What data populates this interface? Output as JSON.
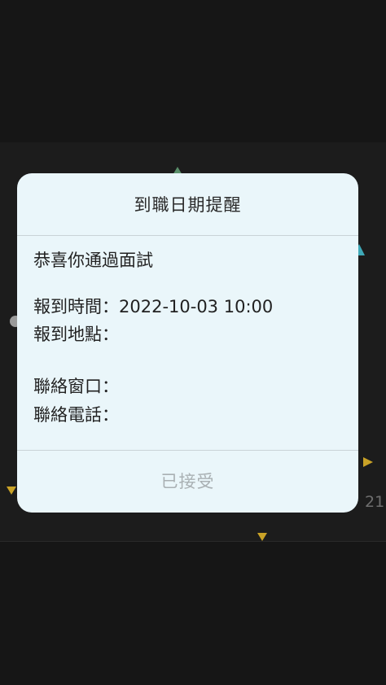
{
  "dialog": {
    "title": "到職日期提醒",
    "congrats": "恭喜你通過面試",
    "report_time_label": "報到時間：",
    "report_time_value": "2022-10-03 10:00",
    "report_place_label": "報到地點：",
    "contact_label": "聯絡窗口：",
    "phone_label": "聯絡電話：",
    "accept_label": "已接受"
  },
  "background": {
    "side_number": "21"
  },
  "colors": {
    "dialog_background": "#eaf6fa",
    "screen_background": "#161616",
    "disabled_text": "#a9b0b3"
  }
}
